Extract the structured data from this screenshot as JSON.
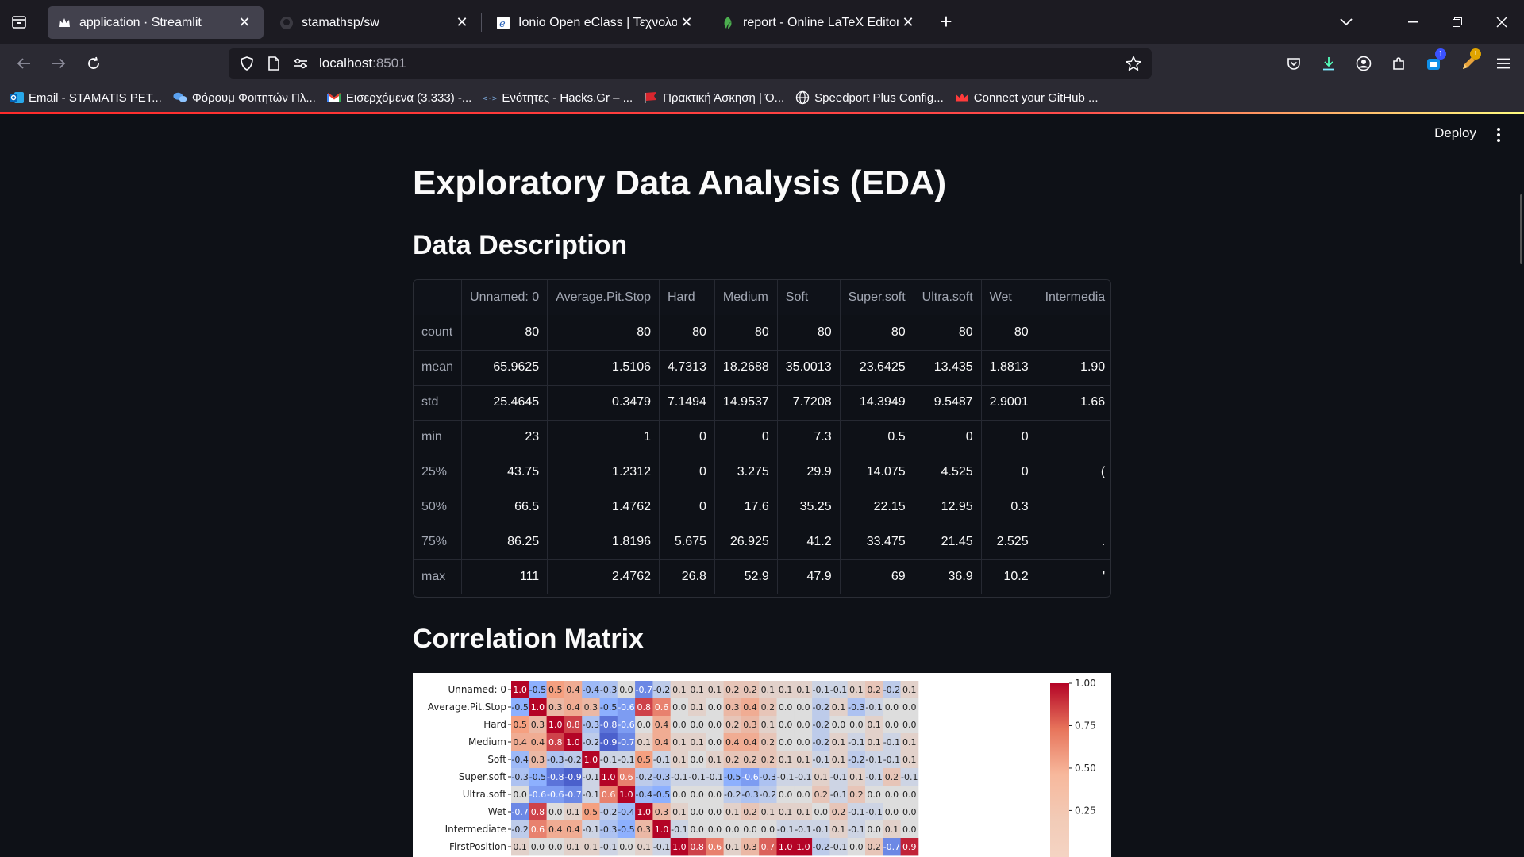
{
  "browser": {
    "tabs": [
      {
        "title": "application · Streamlit",
        "active": true,
        "icon": "streamlit-crown-icon"
      },
      {
        "title": "stamathsp/sw",
        "active": false,
        "icon": "github-icon"
      },
      {
        "title": "Ionio Open eClass | Τεχνολογία",
        "active": false,
        "icon": "eclass-icon"
      },
      {
        "title": "report - Online LaTeX Editor Ov",
        "active": false,
        "icon": "overleaf-icon"
      }
    ],
    "url_host": "localhost",
    "url_port": ":8501",
    "badges": {
      "extensions": "1",
      "profile": "!"
    },
    "bookmarks": [
      {
        "label": "Email - STAMATIS PET...",
        "icon": "outlook-icon"
      },
      {
        "label": "Φόρουμ Φοιτητών Πλ...",
        "icon": "forum-icon"
      },
      {
        "label": "Εισερχόμενα (3.333) -...",
        "icon": "gmail-icon"
      },
      {
        "label": "Ενότητες - Hacks.Gr – ...",
        "icon": "hacks-icon"
      },
      {
        "label": "Πρακτική Άσκηση | Ό...",
        "icon": "flag-icon"
      },
      {
        "label": "Speedport Plus Config...",
        "icon": "globe-icon"
      },
      {
        "label": "Connect your GitHub ...",
        "icon": "crown-icon"
      }
    ]
  },
  "app": {
    "deploy_label": "Deploy",
    "title": "Exploratory Data Analysis (EDA)",
    "section_description": "Data Description",
    "section_correlation": "Correlation Matrix"
  },
  "describe_table": {
    "columns": [
      "",
      "Unnamed: 0",
      "Average.Pit.Stop",
      "Hard",
      "Medium",
      "Soft",
      "Super.soft",
      "Ultra.soft",
      "Wet",
      "Intermedia"
    ],
    "rows": [
      {
        "label": "count",
        "values": [
          "80",
          "80",
          "80",
          "80",
          "80",
          "80",
          "80",
          "80",
          ""
        ]
      },
      {
        "label": "mean",
        "values": [
          "65.9625",
          "1.5106",
          "4.7313",
          "18.2688",
          "35.0013",
          "23.6425",
          "13.435",
          "1.8813",
          "1.90"
        ]
      },
      {
        "label": "std",
        "values": [
          "25.4645",
          "0.3479",
          "7.1494",
          "14.9537",
          "7.7208",
          "14.3949",
          "9.5487",
          "2.9001",
          "1.66"
        ]
      },
      {
        "label": "min",
        "values": [
          "23",
          "1",
          "0",
          "0",
          "7.3",
          "0.5",
          "0",
          "0",
          ""
        ]
      },
      {
        "label": "25%",
        "values": [
          "43.75",
          "1.2312",
          "0",
          "3.275",
          "29.9",
          "14.075",
          "4.525",
          "0",
          "("
        ]
      },
      {
        "label": "50%",
        "values": [
          "66.5",
          "1.4762",
          "0",
          "17.6",
          "35.25",
          "22.15",
          "12.95",
          "0.3",
          ""
        ]
      },
      {
        "label": "75%",
        "values": [
          "86.25",
          "1.8196",
          "5.675",
          "26.925",
          "41.2",
          "33.475",
          "21.45",
          "2.525",
          "."
        ]
      },
      {
        "label": "max",
        "values": [
          "111",
          "2.4762",
          "26.8",
          "52.9",
          "47.9",
          "69",
          "36.9",
          "10.2",
          "'"
        ]
      }
    ]
  },
  "chart_data": {
    "type": "heatmap",
    "title": "",
    "row_labels": [
      "Unnamed: 0",
      "Average.Pit.Stop",
      "Hard",
      "Medium",
      "Soft",
      "Super.soft",
      "Ultra.soft",
      "Wet",
      "Intermediate",
      "FirstPosition"
    ],
    "values": [
      [
        1.0,
        -0.5,
        0.5,
        0.4,
        -0.4,
        -0.3,
        0.0,
        -0.7,
        -0.2,
        0.1,
        0.1,
        0.1,
        0.2,
        0.2,
        0.1,
        0.1,
        0.1,
        -0.1,
        -0.1,
        0.1,
        0.2,
        -0.2,
        0.1
      ],
      [
        -0.5,
        1.0,
        0.3,
        0.4,
        0.3,
        -0.5,
        -0.6,
        0.8,
        0.6,
        -0.0,
        0.1,
        0.0,
        0.3,
        0.4,
        0.2,
        -0.0,
        -0.0,
        -0.2,
        0.1,
        -0.3,
        -0.1,
        -0.0,
        0.0
      ],
      [
        0.5,
        0.3,
        1.0,
        0.8,
        -0.3,
        -0.8,
        -0.6,
        -0.0,
        0.4,
        0.0,
        0.0,
        -0.0,
        0.2,
        0.3,
        0.1,
        -0.0,
        -0.0,
        -0.2,
        -0.0,
        -0.0,
        0.1,
        -0.0,
        0.0
      ],
      [
        0.4,
        0.4,
        0.8,
        1.0,
        -0.2,
        -0.9,
        -0.7,
        0.1,
        0.4,
        0.1,
        0.1,
        0.0,
        0.4,
        0.4,
        0.2,
        0.0,
        0.0,
        -0.2,
        0.1,
        -0.1,
        0.1,
        -0.1,
        0.1
      ],
      [
        -0.4,
        0.3,
        -0.3,
        -0.2,
        1.0,
        -0.1,
        -0.1,
        0.5,
        -0.1,
        0.1,
        0.0,
        0.1,
        0.2,
        0.2,
        0.2,
        0.1,
        0.1,
        -0.1,
        0.1,
        -0.2,
        -0.1,
        -0.1,
        0.1
      ],
      [
        -0.3,
        -0.5,
        -0.8,
        -0.9,
        -0.1,
        1.0,
        0.6,
        -0.2,
        -0.3,
        -0.1,
        -0.1,
        -0.1,
        -0.5,
        -0.6,
        -0.3,
        -0.1,
        -0.1,
        0.1,
        -0.1,
        0.1,
        -0.1,
        0.2,
        -0.1
      ],
      [
        0.0,
        -0.6,
        -0.6,
        -0.7,
        -0.1,
        0.6,
        1.0,
        -0.4,
        -0.5,
        0.0,
        -0.0,
        -0.0,
        -0.2,
        -0.3,
        -0.2,
        0.0,
        0.0,
        0.2,
        -0.1,
        0.2,
        0.0,
        -0.0,
        -0.0
      ],
      [
        -0.7,
        0.8,
        -0.0,
        0.1,
        0.5,
        -0.2,
        -0.4,
        1.0,
        0.3,
        0.1,
        -0.0,
        -0.0,
        0.1,
        0.2,
        0.1,
        0.1,
        0.1,
        0.0,
        0.2,
        -0.1,
        -0.1,
        0.0,
        0.0
      ],
      [
        -0.2,
        0.6,
        0.4,
        0.4,
        -0.1,
        -0.3,
        -0.5,
        0.3,
        1.0,
        -0.1,
        -0.0,
        -0.0,
        0.0,
        0.0,
        -0.0,
        -0.1,
        -0.1,
        -0.1,
        0.1,
        -0.1,
        0.0,
        0.1,
        -0.0
      ],
      [
        0.1,
        -0.0,
        0.0,
        0.1,
        0.1,
        -0.1,
        0.0,
        0.1,
        -0.1,
        1.0,
        0.8,
        0.6,
        0.1,
        0.3,
        0.7,
        1.0,
        1.0,
        -0.2,
        -0.1,
        -0.0,
        0.2,
        -0.7,
        0.9
      ]
    ],
    "colorbar_ticks": [
      "1.00",
      "0.75",
      "0.50",
      "0.25"
    ],
    "value_range": [
      -1.0,
      1.0
    ],
    "colormap": "coolwarm"
  }
}
